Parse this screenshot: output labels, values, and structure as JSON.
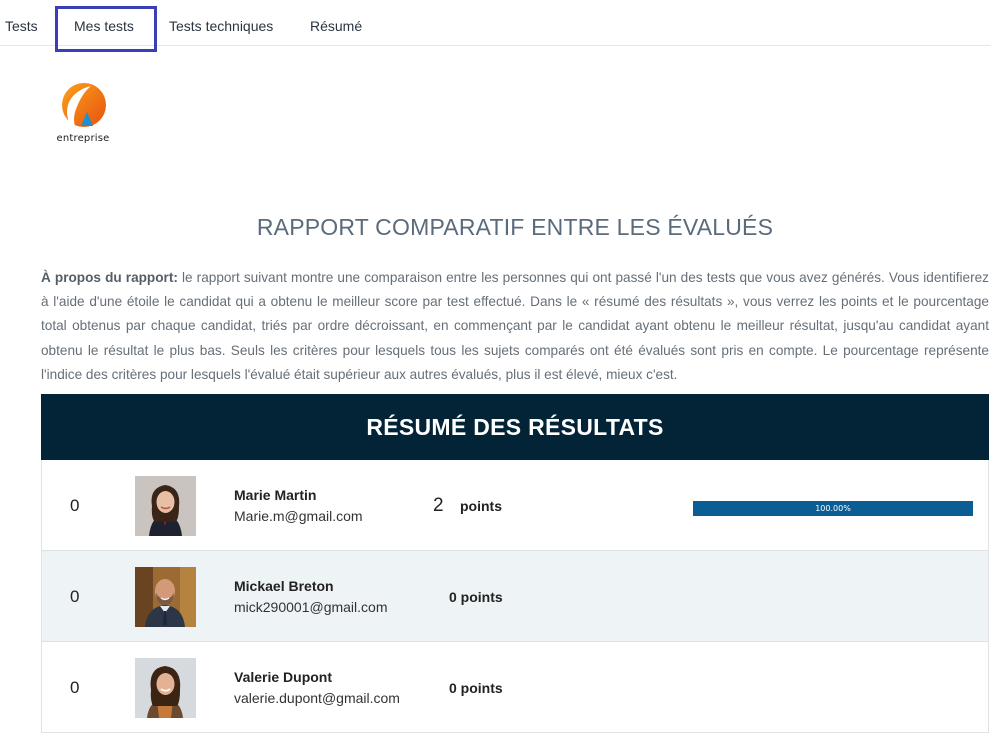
{
  "nav": {
    "items": [
      "Tests",
      "Mes tests",
      "Tests techniques",
      "Résumé"
    ],
    "active": "Mes tests"
  },
  "logo": {
    "text": "entreprise"
  },
  "report": {
    "title": "RAPPORT COMPARATIF ENTRE LES ÉVALUÉS",
    "about_label": "À propos du rapport:",
    "about_text": " le rapport suivant montre une comparaison entre les personnes qui ont passé l'un des tests que vous avez générés. Vous identifierez à l'aide d'une étoile le candidat qui a obtenu le meilleur score par test effectué. Dans le « résumé des résultats », vous verrez les points et le pourcentage total obtenus par chaque candidat, triés par ordre décroissant, en commençant par le candidat ayant obtenu le meilleur résultat, jusqu'au candidat ayant obtenu le résultat le plus bas. Seuls les critères pour lesquels tous les sujets comparés ont été évalués sont pris en compte. Le pourcentage représente l'indice des critères pour lesquels l'évalué était supérieur aux autres évalués, plus il est élevé, mieux c'est."
  },
  "results": {
    "title": "RÉSUMÉ DES RÉSULTATS",
    "rows": [
      {
        "rank": "0",
        "name": "Marie Martin",
        "email": "Marie.m@gmail.com",
        "points_value": "2",
        "points_label": "points",
        "progress_label": "100.00%",
        "progress": 1.0,
        "avatar": "avatar-woman-1"
      },
      {
        "rank": "0",
        "name": "Mickael Breton",
        "email": "mick290001@gmail.com",
        "points_text": "0 points",
        "avatar": "avatar-man-1"
      },
      {
        "rank": "0",
        "name": "Valerie Dupont",
        "email": "valerie.dupont@gmail.com",
        "points_text": "0 points",
        "avatar": "avatar-woman-2"
      }
    ]
  },
  "colors": {
    "header_bg": "#032437",
    "progress": "#0b5e94",
    "nav_highlight": "#3a3fb8",
    "logo_orange": "#f07c1a",
    "logo_blue": "#1e8fd0"
  }
}
